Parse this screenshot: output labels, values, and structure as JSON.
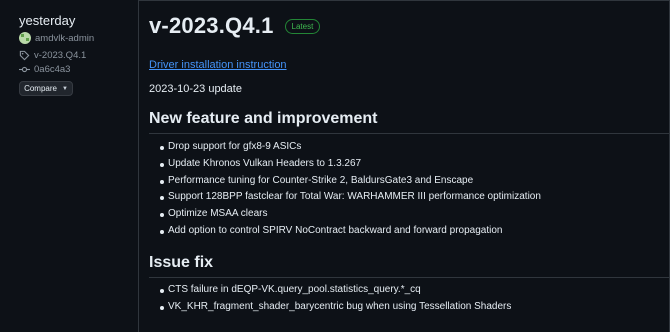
{
  "sidebar": {
    "date": "yesterday",
    "author": "amdvlk-admin",
    "tag": "v-2023.Q4.1",
    "commit": "0a6c4a3",
    "compare_label": "Compare"
  },
  "release": {
    "title": "v-2023.Q4.1",
    "badge": "Latest",
    "driver_link": "Driver installation instruction",
    "update_date": "2023-10-23 update"
  },
  "sections": [
    {
      "heading": "New feature and improvement",
      "items": [
        "Drop support for gfx8-9 ASICs",
        "Update Khronos Vulkan Headers to 1.3.267",
        "Performance tuning for Counter-Strike 2, BaldursGate3 and Enscape",
        "Support 128BPP fastclear for Total War: WARHAMMER III performance optimization",
        "Optimize MSAA clears",
        "Add option to control SPIRV NoContract backward and forward propagation"
      ]
    },
    {
      "heading": "Issue fix",
      "items": [
        "CTS failure in dEQP-VK.query_pool.statistics_query.*_cq",
        "VK_KHR_fragment_shader_barycentric bug when using Tessellation Shaders"
      ]
    }
  ],
  "icons": {
    "avatar": "avatar-identicon",
    "tag": "tag-icon",
    "commit": "git-commit-icon",
    "compare_caret": "triangle-down-icon"
  },
  "colors": {
    "background": "#0d1117",
    "link": "#4493f8",
    "badge_green": "#3fb950",
    "muted_text": "#8b949e",
    "border": "#30363d"
  }
}
